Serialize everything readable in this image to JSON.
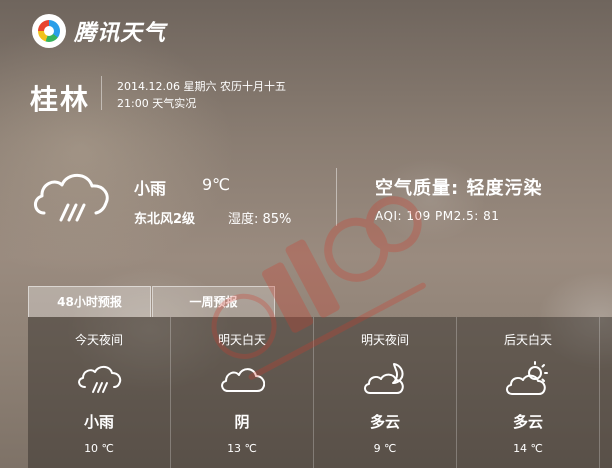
{
  "brand": {
    "name": "腾讯天气"
  },
  "location": {
    "city": "桂林",
    "date_line": "2014.12.06  星期六  农历十月十五",
    "time_line": "21:00  天气实况"
  },
  "current": {
    "condition": "小雨",
    "temperature": "9℃",
    "wind": "东北风2级",
    "humidity": "湿度: 85%",
    "icon": "cloud-rain-icon"
  },
  "air_quality": {
    "title": "空气质量: 轻度污染",
    "detail": "AQI: 109  PM2.5: 81"
  },
  "tabs": [
    {
      "label": "48小时预报"
    },
    {
      "label": "一周预报"
    }
  ],
  "forecast": [
    {
      "when": "今天夜间",
      "icon": "cloud-rain-icon",
      "condition": "小雨",
      "temp": "10 ℃"
    },
    {
      "when": "明天白天",
      "icon": "cloud-icon",
      "condition": "阴",
      "temp": "13 ℃"
    },
    {
      "when": "明天夜间",
      "icon": "moon-cloud-icon",
      "condition": "多云",
      "temp": "9 ℃"
    },
    {
      "when": "后天白天",
      "icon": "sun-cloud-icon",
      "condition": "多云",
      "temp": "14 ℃"
    }
  ],
  "watermark": {
    "text": "桂林生活网 bbs.guilinlife.com",
    "colors": {
      "mark": "#d23a2a"
    }
  },
  "colors": {
    "text": "#ffffff",
    "panel": "rgba(45,40,36,0.45)"
  }
}
